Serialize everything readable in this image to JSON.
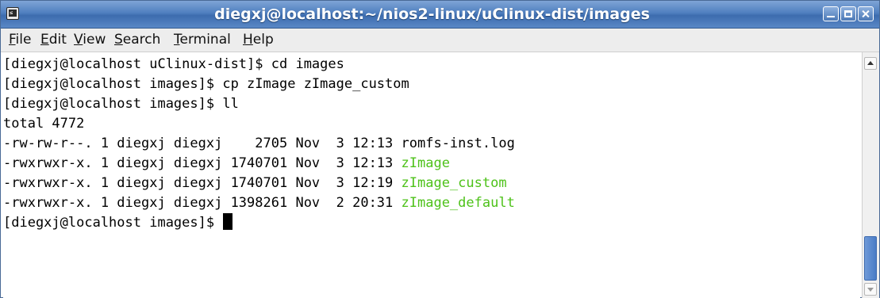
{
  "window": {
    "title": "diegxj@localhost:~/nios2-linux/uClinux-dist/images",
    "app_icon_glyph": "≤"
  },
  "menu": [
    {
      "mnemonic": "F",
      "rest": "ile"
    },
    {
      "mnemonic": "E",
      "rest": "dit"
    },
    {
      "mnemonic": "V",
      "rest": "iew"
    },
    {
      "mnemonic": "S",
      "rest": "earch"
    },
    {
      "mnemonic": "T",
      "rest": "erminal"
    },
    {
      "mnemonic": "H",
      "rest": "elp"
    }
  ],
  "terminal": {
    "lines": [
      {
        "text": "[diegxj@localhost uClinux-dist]$ cd images"
      },
      {
        "text": "[diegxj@localhost images]$ cp zImage zImage_custom"
      },
      {
        "text": "[diegxj@localhost images]$ ll"
      },
      {
        "text": "total 4772"
      },
      {
        "text": "-rw-rw-r--. 1 diegxj diegxj    2705 Nov  3 12:13 ",
        "file": "romfs-inst.log",
        "color": "default"
      },
      {
        "text": "-rwxrwxr-x. 1 diegxj diegxj 1740701 Nov  3 12:13 ",
        "file": "zImage",
        "color": "green"
      },
      {
        "text": "-rwxrwxr-x. 1 diegxj diegxj 1740701 Nov  3 12:19 ",
        "file": "zImage_custom",
        "color": "green"
      },
      {
        "text": "-rwxrwxr-x. 1 diegxj diegxj 1398261 Nov  2 20:31 ",
        "file": "zImage_default",
        "color": "green"
      },
      {
        "text": "[diegxj@localhost images]$ ",
        "cursor": true
      }
    ]
  },
  "colors": {
    "titlebar": "#4f7fbf",
    "executable": "#4ec21a",
    "terminal_bg": "#ffffff",
    "terminal_fg": "#000000"
  },
  "icons": {
    "app": "terminal-app-icon",
    "minimize": "minimize-icon",
    "maximize": "maximize-icon",
    "close": "close-icon",
    "scroll_up": "arrow-up-icon",
    "scroll_down": "arrow-down-icon"
  },
  "scroll": {
    "position_fraction": 0.9
  }
}
